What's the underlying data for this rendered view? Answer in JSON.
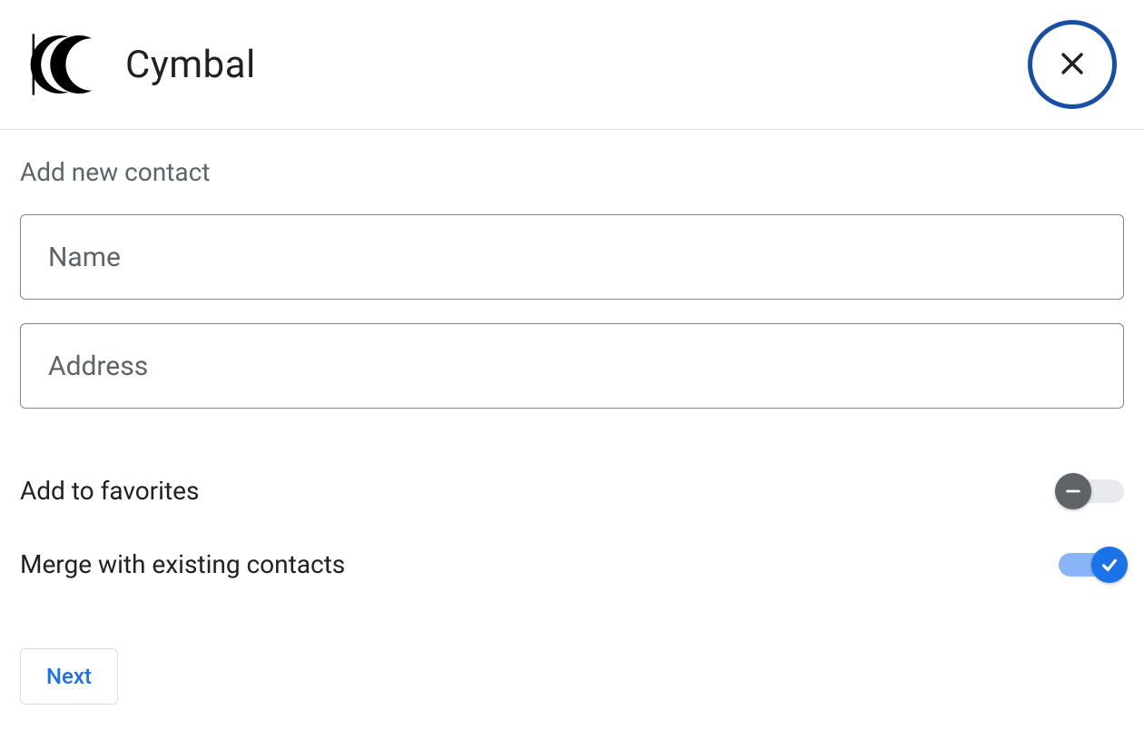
{
  "header": {
    "brand_name": "Cymbal"
  },
  "form": {
    "title": "Add new contact",
    "name_placeholder": "Name",
    "name_value": "",
    "address_placeholder": "Address",
    "address_value": "",
    "favorites_label": "Add to favorites",
    "favorites_on": false,
    "merge_label": "Merge with existing contacts",
    "merge_on": true,
    "next_label": "Next"
  },
  "colors": {
    "close_border": "#174ea6",
    "accent": "#1a73e8",
    "track_on": "#8ab4f8",
    "thumb_off": "#5f6368"
  }
}
